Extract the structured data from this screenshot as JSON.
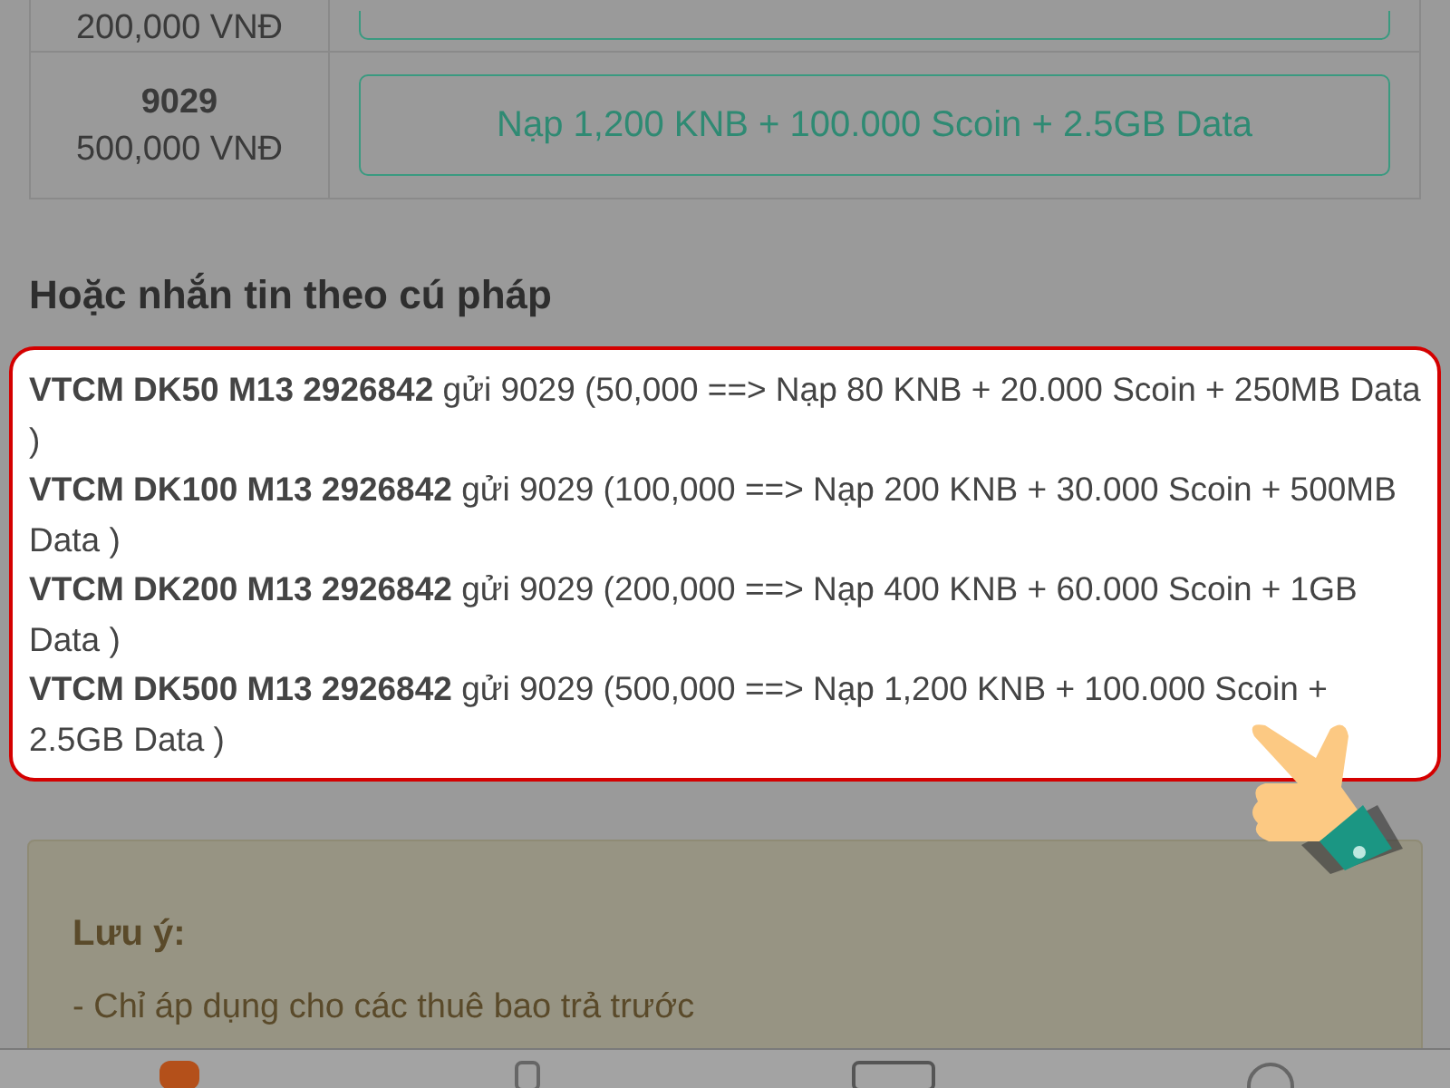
{
  "price_table": {
    "rows": [
      {
        "price": "200,000 VNĐ"
      },
      {
        "code": "9029",
        "price": "500,000 VNĐ",
        "offer": "Nạp 1,200 KNB + 100.000 Scoin + 2.5GB Data"
      }
    ]
  },
  "sms_section": {
    "heading": "Hoặc nhắn tin theo cú pháp",
    "messages": [
      {
        "command": "VTCM DK50 M13 2926842",
        "text": "gửi 9029 (50,000 ==> Nạp 80 KNB + 20.000 Scoin + 250MB Data )"
      },
      {
        "command": "VTCM DK100 M13 2926842",
        "text": "gửi 9029 (100,000 ==> Nạp 200 KNB + 30.000 Scoin + 500MB Data )"
      },
      {
        "command": "VTCM DK200 M13 2926842",
        "text": "gửi 9029 (200,000 ==> Nạp 400 KNB + 60.000 Scoin + 1GB Data )"
      },
      {
        "command": "VTCM DK500 M13 2926842",
        "text": "gửi 9029 (500,000 ==> Nạp 1,200 KNB + 100.000 Scoin + 2.5GB Data )"
      }
    ]
  },
  "note": {
    "title": "Lưu ý:",
    "items": [
      "- Chỉ áp dụng cho các thuê bao trả trước"
    ]
  }
}
